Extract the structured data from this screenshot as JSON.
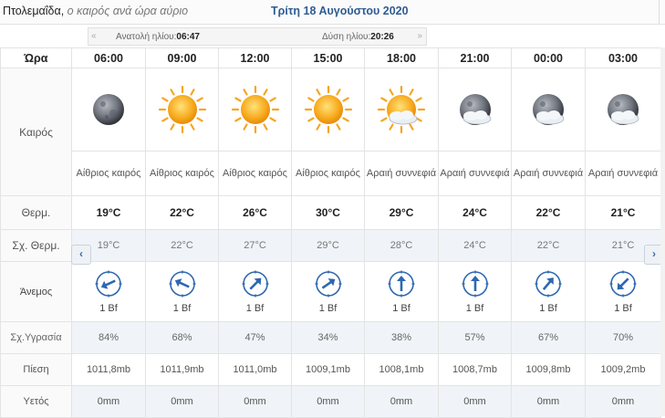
{
  "header": {
    "city": "Πτολεμαΐδα,",
    "subtitle": "ο καιρός ανά ώρα αύριο",
    "date": "Τρίτη 18 Αυγούστου 2020"
  },
  "sun": {
    "prev_arrow": "«",
    "next_arrow": "»",
    "sunrise_label": "Ανατολή ηλίου:",
    "sunrise_time": "06:47",
    "sunset_label": "Δύση ηλίου:",
    "sunset_time": "20:26"
  },
  "nav": {
    "prev": "‹",
    "next": "›"
  },
  "labels": {
    "hour": "Ώρα",
    "weather": "Καιρός",
    "temp": "Θερμ.",
    "feels": "Σχ. Θερμ.",
    "wind": "Άνεμος",
    "humidity": "Σχ.Υγρασία",
    "pressure": "Πίεση",
    "rain": "Υετός"
  },
  "colors": {
    "accent": "#2f5c93",
    "arrow": "#2e67b1",
    "row_alt": "#f0f4f8"
  },
  "hours": [
    {
      "time": "06:00",
      "icon": "moon-icon",
      "desc": "Αίθριος καιρός",
      "temp": "19°C",
      "feels": "19°C",
      "wind_dir": "arrow-east-northeast",
      "wind_angle": 65,
      "wind": "1 Bf",
      "humidity": "84%",
      "pressure": "1011,8mb",
      "rain": "0mm"
    },
    {
      "time": "09:00",
      "icon": "sun-icon",
      "desc": "Αίθριος καιρός",
      "temp": "22°C",
      "feels": "22°C",
      "wind_dir": "arrow-east-southeast",
      "wind_angle": 115,
      "wind": "1 Bf",
      "humidity": "68%",
      "pressure": "1011,9mb",
      "rain": "0mm"
    },
    {
      "time": "12:00",
      "icon": "sun-icon",
      "desc": "Αίθριος καιρός",
      "temp": "26°C",
      "feels": "27°C",
      "wind_dir": "arrow-southwest",
      "wind_angle": 225,
      "wind": "1 Bf",
      "humidity": "47%",
      "pressure": "1011,0mb",
      "rain": "0mm"
    },
    {
      "time": "15:00",
      "icon": "sun-icon",
      "desc": "Αίθριος καιρός",
      "temp": "30°C",
      "feels": "29°C",
      "wind_dir": "arrow-southwest",
      "wind_angle": 235,
      "wind": "1 Bf",
      "humidity": "34%",
      "pressure": "1009,1mb",
      "rain": "0mm"
    },
    {
      "time": "18:00",
      "icon": "sun-cloud-icon",
      "desc": "Αραιή συννεφιά",
      "temp": "29°C",
      "feels": "28°C",
      "wind_dir": "arrow-south",
      "wind_angle": 180,
      "wind": "1 Bf",
      "humidity": "38%",
      "pressure": "1008,1mb",
      "rain": "0mm"
    },
    {
      "time": "21:00",
      "icon": "moon-cloud-icon",
      "desc": "Αραιή συννεφιά",
      "temp": "24°C",
      "feels": "24°C",
      "wind_dir": "arrow-south",
      "wind_angle": 180,
      "wind": "1 Bf",
      "humidity": "57%",
      "pressure": "1008,7mb",
      "rain": "0mm"
    },
    {
      "time": "00:00",
      "icon": "moon-cloud-icon",
      "desc": "Αραιή συννεφιά",
      "temp": "22°C",
      "feels": "22°C",
      "wind_dir": "arrow-southwest",
      "wind_angle": 220,
      "wind": "1 Bf",
      "humidity": "67%",
      "pressure": "1009,8mb",
      "rain": "0mm"
    },
    {
      "time": "03:00",
      "icon": "moon-cloud-icon",
      "desc": "Αραιή συννεφιά",
      "temp": "21°C",
      "feels": "21°C",
      "wind_dir": "arrow-northeast",
      "wind_angle": 45,
      "wind": "1 Bf",
      "humidity": "70%",
      "pressure": "1009,2mb",
      "rain": "0mm"
    }
  ]
}
